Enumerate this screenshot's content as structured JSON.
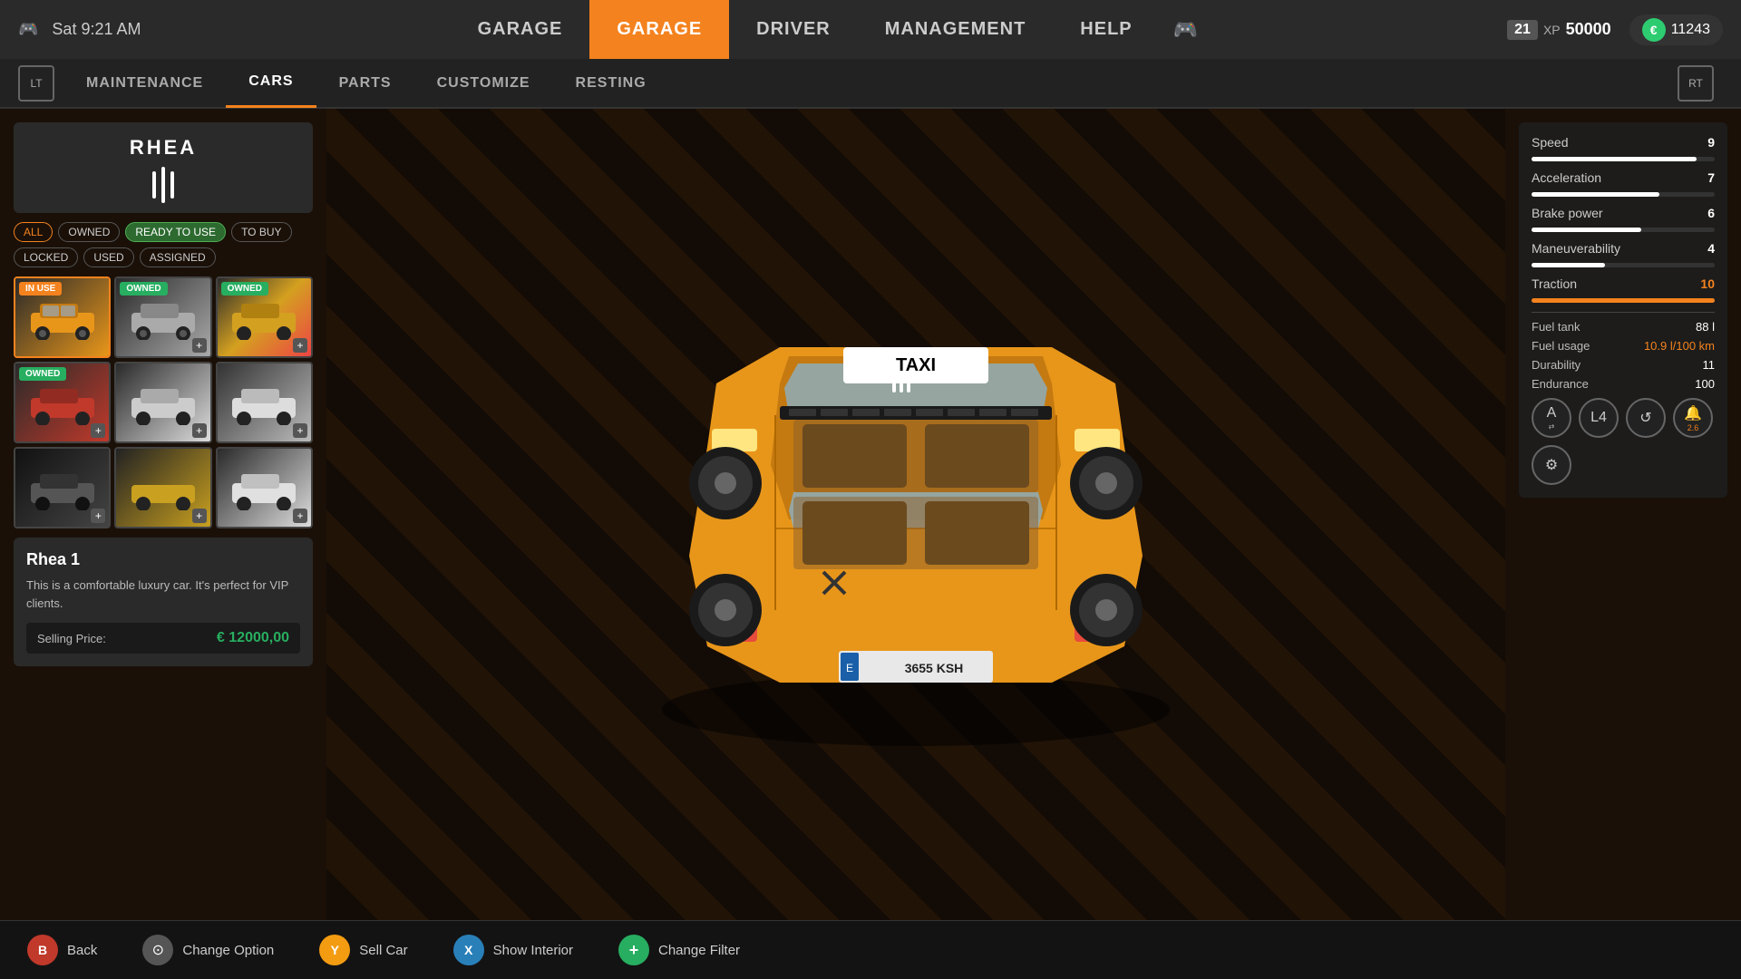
{
  "topbar": {
    "datetime": "Sat  9:21 AM",
    "nav_items": [
      "GARAGE",
      "DRIVER",
      "MANAGEMENT",
      "HELP"
    ],
    "active_nav": "GARAGE",
    "level": "21",
    "xp_label": "XP",
    "xp_value": "50000",
    "money_value": "11243",
    "euro_symbol": "€"
  },
  "subnav": {
    "items": [
      "LT",
      "MAINTENANCE",
      "CARS",
      "PARTS",
      "CUSTOMIZE",
      "RESTING",
      "RT"
    ],
    "active": "CARS"
  },
  "brand": {
    "name": "RHEA"
  },
  "filters": {
    "tags": [
      "ALL",
      "OWNED",
      "READY TO USE",
      "TO BUY",
      "LOCKED",
      "USED",
      "ASSIGNED"
    ]
  },
  "car_grid": [
    {
      "badge": "IN USE",
      "badge_type": "in-use",
      "thumb_class": "thumb-yellow",
      "emoji": "🚗"
    },
    {
      "badge": "OWNED",
      "badge_type": "owned",
      "thumb_class": "thumb-silver",
      "emoji": "🚗"
    },
    {
      "badge": "OWNED",
      "badge_type": "owned",
      "thumb_class": "thumb-pattern",
      "emoji": "🚗"
    },
    {
      "badge": "OWNED",
      "badge_type": "owned",
      "thumb_class": "thumb-red",
      "emoji": "🚗"
    },
    {
      "badge": "",
      "badge_type": "",
      "thumb_class": "thumb-white",
      "emoji": "🚗"
    },
    {
      "badge": "",
      "badge_type": "",
      "thumb_class": "thumb-white2",
      "emoji": "🚗"
    },
    {
      "badge": "",
      "badge_type": "",
      "thumb_class": "thumb-dark",
      "emoji": "🚗"
    },
    {
      "badge": "",
      "badge_type": "",
      "thumb_class": "thumb-open",
      "emoji": "🚗"
    },
    {
      "badge": "",
      "badge_type": "",
      "thumb_class": "thumb-white",
      "emoji": "🚗"
    }
  ],
  "car_info": {
    "name": "Rhea 1",
    "description": "This is a comfortable luxury car. It's perfect for VIP clients.",
    "selling_price_label": "Selling Price:",
    "selling_price": "€ 12000,00"
  },
  "stats": {
    "speed_label": "Speed",
    "speed_value": "9",
    "speed_pct": 90,
    "acceleration_label": "Acceleration",
    "acceleration_value": "7",
    "acceleration_pct": 70,
    "brake_label": "Brake power",
    "brake_value": "6",
    "brake_pct": 60,
    "maneuverability_label": "Maneuverability",
    "maneuverability_value": "4",
    "maneuverability_pct": 40,
    "traction_label": "Traction",
    "traction_value": "10",
    "traction_pct": 100,
    "fuel_tank_label": "Fuel tank",
    "fuel_tank_value": "88 l",
    "fuel_usage_label": "Fuel usage",
    "fuel_usage_value": "10.9 l/100 km",
    "durability_label": "Durability",
    "durability_value": "11",
    "endurance_label": "Endurance",
    "endurance_value": "100"
  },
  "icons": [
    {
      "sym": "A",
      "sub": "",
      "type": "trans"
    },
    {
      "sym": "L4",
      "sub": "",
      "type": "gear"
    },
    {
      "sym": "↺",
      "sub": "",
      "type": "drive"
    },
    {
      "sym": "🔔",
      "sub": "2.6",
      "type": "alert"
    },
    {
      "sym": "⚙",
      "sub": "",
      "type": "settings"
    }
  ],
  "bottom_actions": [
    {
      "btn": "B",
      "btn_class": "btn-b",
      "label": "Back"
    },
    {
      "btn": "⊙",
      "btn_class": "btn-label-icon",
      "label": "Change Option"
    },
    {
      "btn": "Y",
      "btn_class": "btn-y",
      "label": "Sell Car"
    },
    {
      "btn": "X",
      "btn_class": "btn-x",
      "label": "Show Interior"
    },
    {
      "btn": "+",
      "btn_class": "btn-plus",
      "label": "Change Filter"
    }
  ],
  "taxi": {
    "sign_text": "TAXI",
    "plate": "3655 KSH",
    "plate_prefix": "E"
  }
}
